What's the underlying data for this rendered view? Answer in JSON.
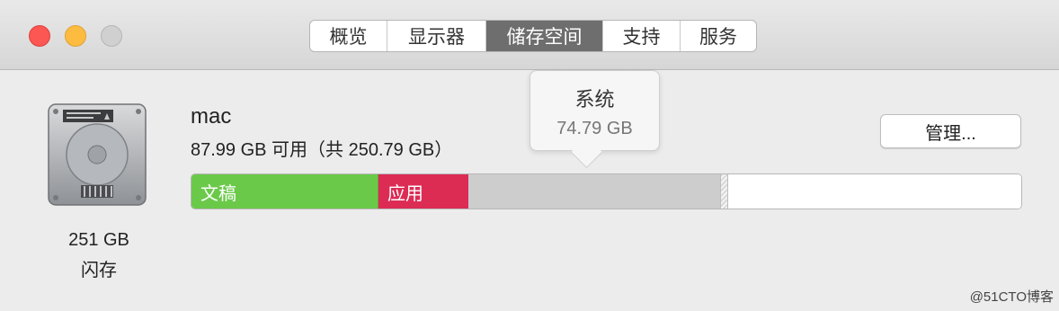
{
  "window": {
    "tabs": [
      {
        "label": "概览",
        "active": false
      },
      {
        "label": "显示器",
        "active": false
      },
      {
        "label": "储存空间",
        "active": true
      },
      {
        "label": "支持",
        "active": false
      },
      {
        "label": "服务",
        "active": false
      }
    ]
  },
  "disk": {
    "name": "mac",
    "available_text": "87.99 GB 可用（共 250.79 GB）",
    "size_label": "251 GB",
    "type_label": "闪存",
    "manage_button": "管理..."
  },
  "storage_bar": {
    "total_gb": 250.79,
    "segments": [
      {
        "key": "docs",
        "label": "文稿",
        "fraction": 0.225,
        "color": "#6bc94a"
      },
      {
        "key": "apps",
        "label": "应用",
        "fraction": 0.108,
        "color": "#dc2c54"
      },
      {
        "key": "system",
        "label": "",
        "fraction": 0.303,
        "color": "#cdcdcd"
      },
      {
        "key": "other",
        "label": "",
        "fraction": 0.01,
        "color": "#e6e6e6"
      }
    ]
  },
  "tooltip": {
    "title": "系统",
    "value": "74.79 GB"
  },
  "watermark": "@51CTO博客"
}
